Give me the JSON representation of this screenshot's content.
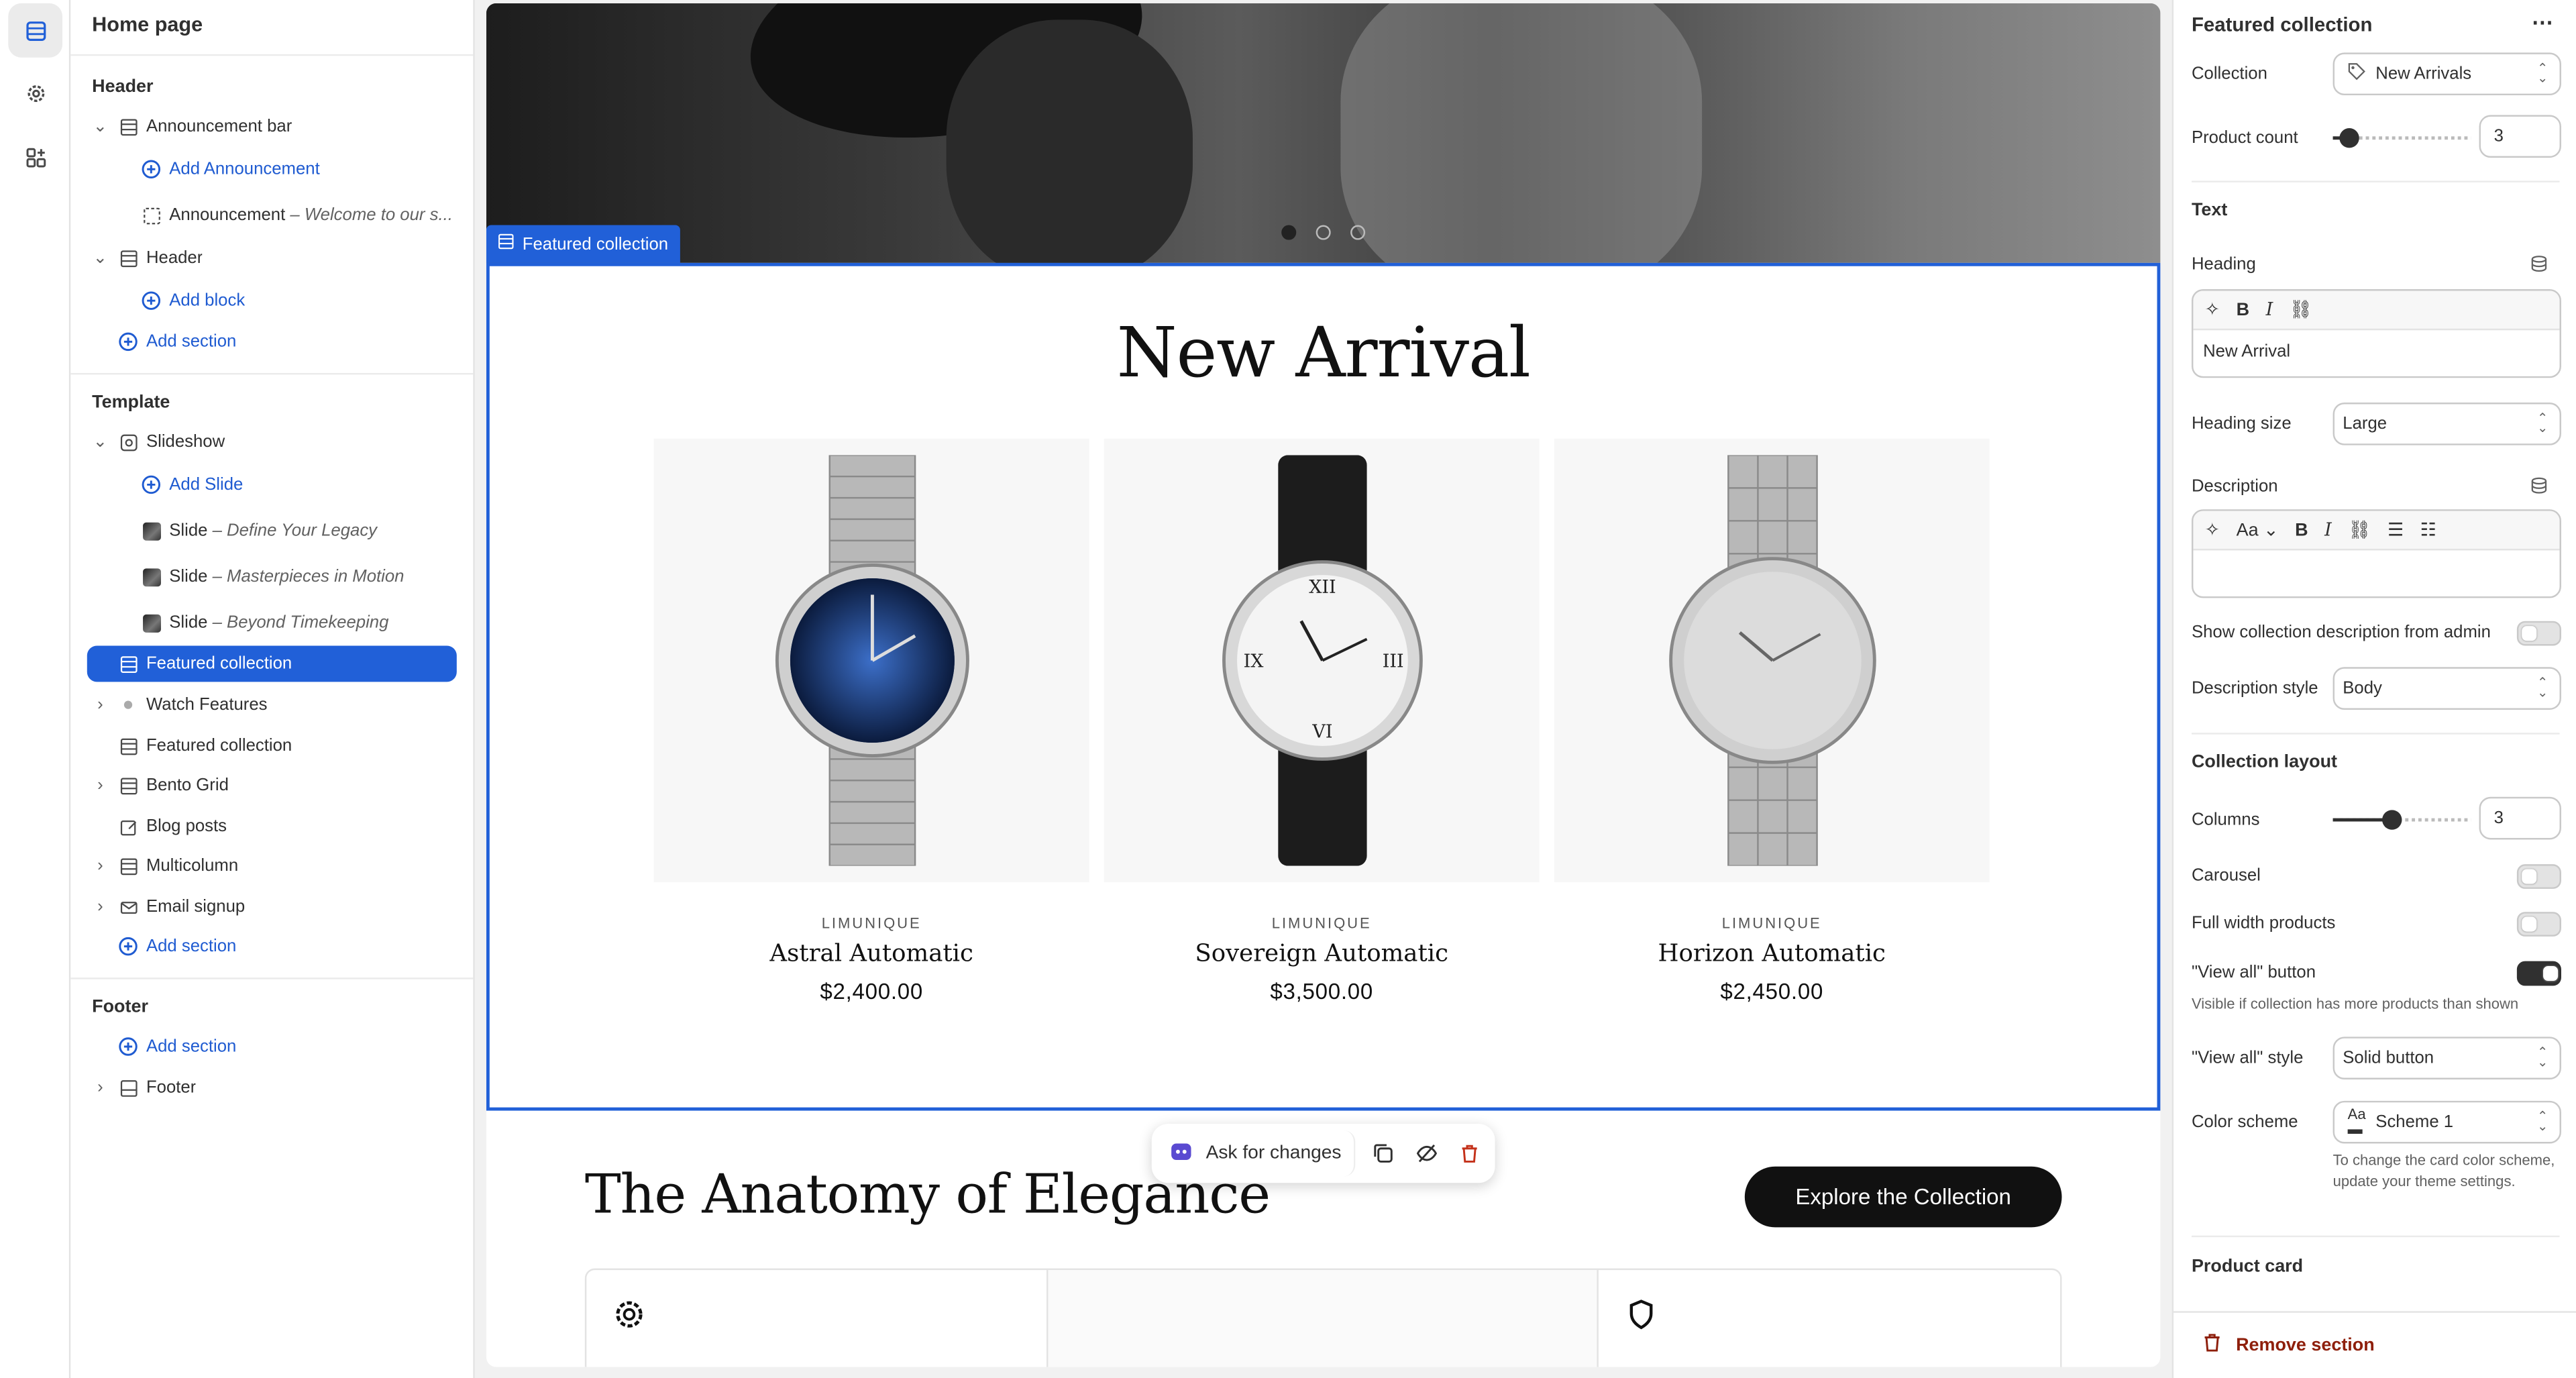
{
  "page_title": "Home page",
  "rail": [
    "sections-icon",
    "settings-icon",
    "apps-icon"
  ],
  "sidebar": {
    "header_group": "Header",
    "announcement_bar": "Announcement bar",
    "add_announcement": "Add Announcement",
    "announcement_label": "Announcement",
    "announcement_sub": "– Welcome to our s...",
    "header_item": "Header",
    "add_block": "Add block",
    "add_section_1": "Add section",
    "template_group": "Template",
    "slideshow": "Slideshow",
    "add_slide": "Add Slide",
    "slides": [
      {
        "label": "Slide",
        "sub": "– Define Your Legacy"
      },
      {
        "label": "Slide",
        "sub": "– Masterpieces in Motion"
      },
      {
        "label": "Slide",
        "sub": "– Beyond Timekeeping"
      }
    ],
    "featured_collection_selected": "Featured collection",
    "watch_features": "Watch Features",
    "featured_collection_2": "Featured collection",
    "bento_grid": "Bento Grid",
    "blog_posts": "Blog posts",
    "multicolumn": "Multicolumn",
    "email_signup": "Email signup",
    "add_section_2": "Add section",
    "footer_group": "Footer",
    "add_section_3": "Add section",
    "footer_item": "Footer"
  },
  "canvas": {
    "section_tag": "Featured collection",
    "collection_title": "New Arrival",
    "products": [
      {
        "brand": "LIMUNIQUE",
        "name": "Astral Automatic",
        "price": "$2,400.00",
        "dial": "#1b3a78"
      },
      {
        "brand": "LIMUNIQUE",
        "name": "Sovereign Automatic",
        "price": "$3,500.00",
        "dial": "#f4f4f4"
      },
      {
        "brand": "LIMUNIQUE",
        "name": "Horizon Automatic",
        "price": "$2,450.00",
        "dial": "#d9d9d9"
      }
    ],
    "anatomy_title": "The Anatomy of Elegance",
    "explore_button": "Explore the Collection",
    "toolbar": {
      "ask": "Ask for changes"
    }
  },
  "panel": {
    "title": "Featured collection",
    "collection_label": "Collection",
    "collection_value": "New Arrivals",
    "product_count_label": "Product count",
    "product_count": "3",
    "text_heading": "Text",
    "heading_label": "Heading",
    "heading_value": "New Arrival",
    "heading_size_label": "Heading size",
    "heading_size_value": "Large",
    "description_label": "Description",
    "show_desc_label": "Show collection description from admin",
    "desc_style_label": "Description style",
    "desc_style_value": "Body",
    "layout_heading": "Collection layout",
    "columns_label": "Columns",
    "columns_value": "3",
    "carousel_label": "Carousel",
    "full_width_label": "Full width products",
    "view_all_label": "\"View all\" button",
    "view_all_help": "Visible if collection has more products than shown",
    "view_all_style_label": "\"View all\" style",
    "view_all_style_value": "Solid button",
    "color_scheme_label": "Color scheme",
    "color_scheme_value": "Scheme 1",
    "color_scheme_help": "To change the card color scheme, update your theme settings.",
    "product_card_heading": "Product card",
    "remove_section": "Remove section",
    "toggles": {
      "show_desc": false,
      "carousel": false,
      "full_width": false,
      "view_all": true
    },
    "product_count_fraction": 0.05,
    "columns_fraction": 0.42
  },
  "colors": {
    "accent": "#2160d8",
    "danger": "#8e1f0b",
    "dark": "#111111"
  }
}
